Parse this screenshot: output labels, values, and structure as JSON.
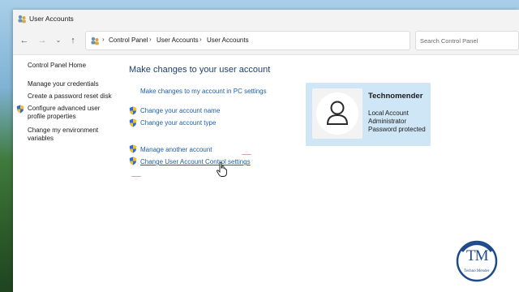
{
  "window": {
    "title": "User Accounts"
  },
  "address_bar": {
    "breadcrumbs": [
      "Control Panel",
      "User Accounts",
      "User Accounts"
    ],
    "search_placeholder": "Search Control Panel"
  },
  "sidebar": {
    "items": [
      {
        "label": "Control Panel Home",
        "shield": false
      },
      {
        "label": "Manage your credentials",
        "shield": false
      },
      {
        "label": "Create a password reset disk",
        "shield": false
      },
      {
        "label": "Configure advanced user",
        "label2": "profile properties",
        "shield": true
      },
      {
        "label": "Change my environment",
        "label2": "variables",
        "shield": false
      }
    ]
  },
  "main": {
    "heading": "Make changes to your user account",
    "links": [
      {
        "label": "Make changes to my account in PC settings",
        "shield": false
      },
      {
        "label": "Change your account name",
        "shield": true
      },
      {
        "label": "Change your account type",
        "shield": true
      },
      {
        "label": "Manage another account",
        "shield": true
      },
      {
        "label": "Change User Account Control settings",
        "shield": true,
        "hover": true
      }
    ]
  },
  "account": {
    "name": "Technomender",
    "lines": [
      "Local Account",
      "Administrator",
      "Password protected"
    ]
  },
  "watermark": {
    "initials": "TM",
    "text": "Techno Mender"
  },
  "colors": {
    "link": "#1e5fa8",
    "heading": "#1f3f6e",
    "card": "#cfe6f6",
    "shield_blue": "#2f6bd6",
    "shield_yellow": "#f2c12e"
  }
}
